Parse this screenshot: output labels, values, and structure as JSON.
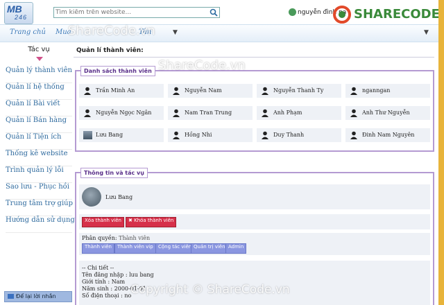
{
  "header": {
    "logo_top": "MB",
    "logo_bottom": "246",
    "search_placeholder": "Tìm kiếm trên website...",
    "user_name": "nguyễn đình na",
    "brand": "SHARECODE.vn"
  },
  "nav": {
    "items": [
      "Trang chủ",
      "Mua",
      "Tân"
    ]
  },
  "watermarks": {
    "top": "ShareCode.vn",
    "mid": "ShareCode.vn",
    "bottom": "Copyright © ShareCode.vn"
  },
  "sidebar": {
    "tab_title": "Tác vụ",
    "items": [
      "Quản lý thành viên",
      "Quản lí hệ thống",
      "Quản lí Bài viết",
      "Quản lí Bán hàng",
      "Quản lí Tiện ích",
      "Thống kê website",
      "Trình quản lý lỗi",
      "Sao lưu - Phục hồi",
      "Trung tâm trợ giúp",
      "Hướng dẫn sử dụng"
    ],
    "leave_message": "Để lại lời nhắn"
  },
  "main": {
    "page_title": "Quản lí thành viên:",
    "members_legend": "Danh sách thành viên",
    "members": [
      [
        "Trần Minh An",
        "Nguyễn Nam",
        "Nguyễn Thanh Ty",
        "nganngan"
      ],
      [
        "Nguyễn Ngọc Ngân",
        "Nam Tran Trung",
        "Anh Phạm",
        "Anh Thư Nguyễn"
      ],
      [
        "Lưu Bang",
        "Hồng Nhi",
        "Duy Thanh",
        "Đinh Nam Nguyên"
      ]
    ],
    "info_legend": "Thông tin và tác vụ",
    "selected_name": "Lưu Bang",
    "delete_button": "Xóa thành viên",
    "ban_button": "Khóa thành viên",
    "permission_label": "Phân quyền:",
    "permission_value": "Thành viên",
    "roles": [
      "Thành viên",
      "Thành viên vip",
      "Cộng tác viên",
      "Quản trị viên",
      "Admin"
    ],
    "details_header": "-- Chi tiết --",
    "details": [
      "Tên đăng nhập : luu bang",
      "Giới tính : Nam",
      "Năm sinh : 2000-01-01",
      "Số điện thoại : no"
    ]
  }
}
